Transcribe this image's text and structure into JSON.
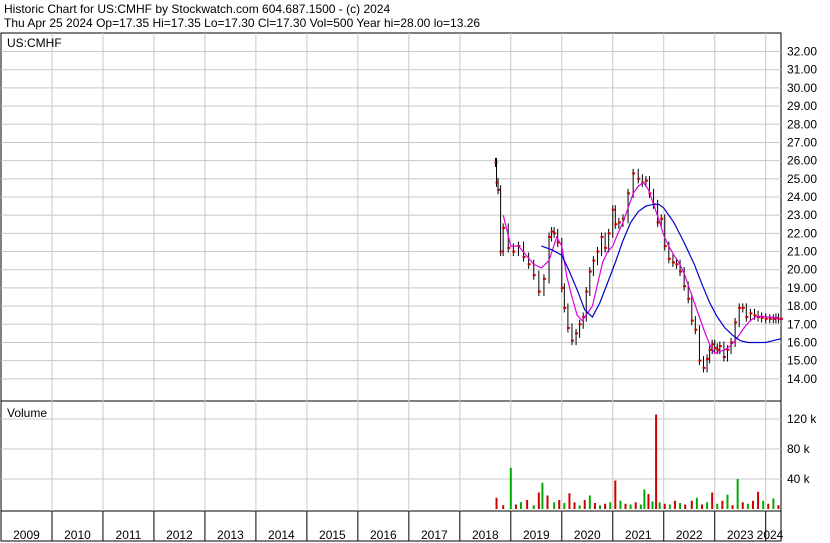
{
  "header": {
    "line1": "Historic Chart for US:CMHF by Stockwatch.com 604.687.1500 - (c) 2024",
    "line2": "Thu Apr 25 2024   Op=17.35   Hi=17.35   Lo=17.30   Cl=17.30   Vol=500   Year hi=28.00   lo=13.26"
  },
  "chart_data": [
    {
      "type": "line",
      "title": "US:CMHF",
      "ylim": [
        13,
        32.8
      ],
      "xlim": [
        2009,
        2024.3
      ],
      "y_ticks": [
        "32.00",
        "31.00",
        "30.00",
        "29.00",
        "28.00",
        "27.00",
        "26.00",
        "25.00",
        "24.00",
        "23.00",
        "22.00",
        "21.00",
        "20.00",
        "19.00",
        "18.00",
        "17.00",
        "16.00",
        "15.00",
        "14.00"
      ],
      "x_ticks": [
        "2009",
        "2010",
        "2011",
        "2012",
        "2013",
        "2014",
        "2015",
        "2016",
        "2017",
        "2018",
        "2019",
        "2020",
        "2021",
        "2022",
        "2023",
        "2024"
      ],
      "grid": true,
      "colors": {
        "price": "#cc0000",
        "ma_short": "#e000e0",
        "ma_long": "#0000cc",
        "grid": "#c8c8c8"
      },
      "series": [
        {
          "key": "price",
          "x": [
            2018.7,
            2018.72,
            2018.75,
            2018.8,
            2018.85,
            2018.95,
            2019.05,
            2019.15,
            2019.25,
            2019.35,
            2019.45,
            2019.55,
            2019.65,
            2019.75,
            2019.8,
            2019.85,
            2019.92,
            2020.0,
            2020.05,
            2020.12,
            2020.2,
            2020.28,
            2020.35,
            2020.42,
            2020.48,
            2020.55,
            2020.62,
            2020.7,
            2020.78,
            2020.85,
            2020.92,
            2021.0,
            2021.05,
            2021.12,
            2021.2,
            2021.3,
            2021.4,
            2021.5,
            2021.58,
            2021.65,
            2021.72,
            2021.8,
            2021.88,
            2021.95,
            2022.02,
            2022.1,
            2022.18,
            2022.25,
            2022.32,
            2022.4,
            2022.48,
            2022.55,
            2022.62,
            2022.7,
            2022.78,
            2022.85,
            2022.9,
            2022.95,
            2023.0,
            2023.05,
            2023.1,
            2023.18,
            2023.25,
            2023.32,
            2023.4,
            2023.48,
            2023.55,
            2023.62,
            2023.7,
            2023.78,
            2023.85,
            2023.92,
            2024.0,
            2024.08,
            2024.15,
            2024.2,
            2024.25,
            2024.3
          ],
          "values": [
            25.9,
            24.8,
            24.4,
            21.0,
            22.3,
            21.2,
            21.0,
            21.3,
            20.7,
            20.3,
            19.7,
            18.8,
            19.5,
            21.8,
            22.1,
            22.0,
            21.5,
            19.0,
            17.9,
            16.8,
            16.1,
            16.5,
            17.0,
            17.4,
            18.8,
            19.9,
            20.5,
            21.0,
            21.8,
            21.2,
            22.0,
            23.3,
            22.5,
            22.6,
            22.8,
            24.2,
            25.3,
            25.0,
            24.8,
            24.9,
            24.2,
            23.6,
            22.6,
            22.8,
            21.3,
            20.6,
            20.4,
            20.3,
            19.9,
            19.1,
            18.4,
            17.2,
            16.7,
            15.0,
            14.6,
            15.1,
            15.6,
            15.9,
            15.7,
            15.6,
            15.8,
            15.2,
            15.6,
            16.0,
            17.1,
            17.9,
            17.9,
            17.4,
            17.6,
            17.5,
            17.4,
            17.35,
            17.3,
            17.3,
            17.3,
            17.35,
            17.3,
            17.3
          ]
        },
        {
          "key": "ma_short",
          "x": [
            2018.85,
            2019.0,
            2019.15,
            2019.3,
            2019.45,
            2019.6,
            2019.75,
            2019.9,
            2020.0,
            2020.1,
            2020.2,
            2020.3,
            2020.4,
            2020.5,
            2020.6,
            2020.7,
            2020.8,
            2020.9,
            2021.0,
            2021.1,
            2021.2,
            2021.3,
            2021.4,
            2021.5,
            2021.6,
            2021.7,
            2021.8,
            2021.9,
            2022.0,
            2022.1,
            2022.2,
            2022.3,
            2022.4,
            2022.5,
            2022.6,
            2022.7,
            2022.8,
            2022.9,
            2023.0,
            2023.1,
            2023.2,
            2023.3,
            2023.4,
            2023.5,
            2023.6,
            2023.7,
            2023.8,
            2023.9,
            2024.0,
            2024.1,
            2024.2,
            2024.3
          ],
          "values": [
            23.0,
            21.3,
            21.3,
            20.8,
            20.3,
            20.1,
            20.5,
            21.8,
            21.3,
            19.6,
            18.5,
            17.5,
            17.2,
            17.6,
            18.0,
            19.2,
            20.4,
            21.0,
            21.3,
            22.0,
            22.6,
            23.4,
            24.2,
            24.6,
            24.8,
            24.4,
            23.6,
            22.8,
            21.9,
            21.3,
            20.8,
            20.4,
            19.8,
            19.0,
            18.2,
            17.4,
            16.6,
            15.9,
            15.4,
            15.5,
            15.6,
            15.8,
            16.1,
            16.5,
            16.9,
            17.2,
            17.4,
            17.45,
            17.4,
            17.4,
            17.35,
            17.3
          ]
        },
        {
          "key": "ma_long",
          "x": [
            2019.6,
            2019.8,
            2020.0,
            2020.15,
            2020.3,
            2020.45,
            2020.6,
            2020.75,
            2020.9,
            2021.05,
            2021.2,
            2021.35,
            2021.5,
            2021.65,
            2021.8,
            2021.9,
            2022.0,
            2022.2,
            2022.4,
            2022.6,
            2022.75,
            2022.9,
            2023.05,
            2023.2,
            2023.35,
            2023.5,
            2023.65,
            2023.8,
            2023.9,
            2024.0,
            2024.15,
            2024.3
          ],
          "values": [
            21.3,
            21.1,
            20.8,
            19.9,
            18.9,
            17.8,
            17.4,
            18.2,
            19.3,
            20.4,
            21.6,
            22.6,
            23.2,
            23.5,
            23.6,
            23.6,
            23.4,
            22.6,
            21.5,
            20.3,
            19.2,
            18.2,
            17.4,
            16.8,
            16.4,
            16.1,
            16.0,
            16.0,
            16.0,
            16.0,
            16.1,
            16.2
          ]
        }
      ]
    },
    {
      "type": "bar",
      "title": "Volume",
      "ylim": [
        0,
        140
      ],
      "y_ticks": [
        "120 k",
        "80 k",
        "40 k"
      ],
      "unit": "k",
      "colors": {
        "up": "#00aa00",
        "down": "#cc0000",
        "flat": "#888888"
      },
      "x": [
        2018.72,
        2018.85,
        2019.0,
        2019.1,
        2019.2,
        2019.32,
        2019.45,
        2019.55,
        2019.62,
        2019.72,
        2019.85,
        2019.95,
        2020.05,
        2020.15,
        2020.25,
        2020.35,
        2020.45,
        2020.55,
        2020.65,
        2020.75,
        2020.85,
        2020.95,
        2021.05,
        2021.15,
        2021.25,
        2021.35,
        2021.45,
        2021.55,
        2021.62,
        2021.7,
        2021.78,
        2021.85,
        2021.92,
        2022.02,
        2022.12,
        2022.22,
        2022.32,
        2022.42,
        2022.55,
        2022.65,
        2022.75,
        2022.85,
        2022.95,
        2023.05,
        2023.15,
        2023.25,
        2023.35,
        2023.45,
        2023.55,
        2023.65,
        2023.75,
        2023.85,
        2023.95,
        2024.05,
        2024.15,
        2024.25
      ],
      "values": [
        15,
        5,
        55,
        6,
        9,
        12,
        5,
        22,
        35,
        18,
        9,
        12,
        8,
        21,
        9,
        5,
        12,
        18,
        8,
        5,
        7,
        9,
        38,
        11,
        7,
        6,
        9,
        6,
        26,
        20,
        10,
        126,
        9,
        7,
        6,
        11,
        8,
        6,
        11,
        15,
        6,
        9,
        22,
        7,
        11,
        19,
        5,
        40,
        9,
        7,
        11,
        23,
        11,
        7,
        14,
        5
      ],
      "up": [
        false,
        false,
        true,
        false,
        true,
        false,
        true,
        false,
        true,
        false,
        true,
        false,
        true,
        false,
        false,
        true,
        false,
        true,
        false,
        true,
        false,
        true,
        false,
        true,
        false,
        true,
        false,
        true,
        true,
        false,
        true,
        false,
        true,
        false,
        true,
        false,
        true,
        false,
        false,
        true,
        false,
        true,
        false,
        true,
        false,
        true,
        false,
        true,
        false,
        true,
        false,
        false,
        true,
        false,
        true,
        false
      ]
    }
  ]
}
